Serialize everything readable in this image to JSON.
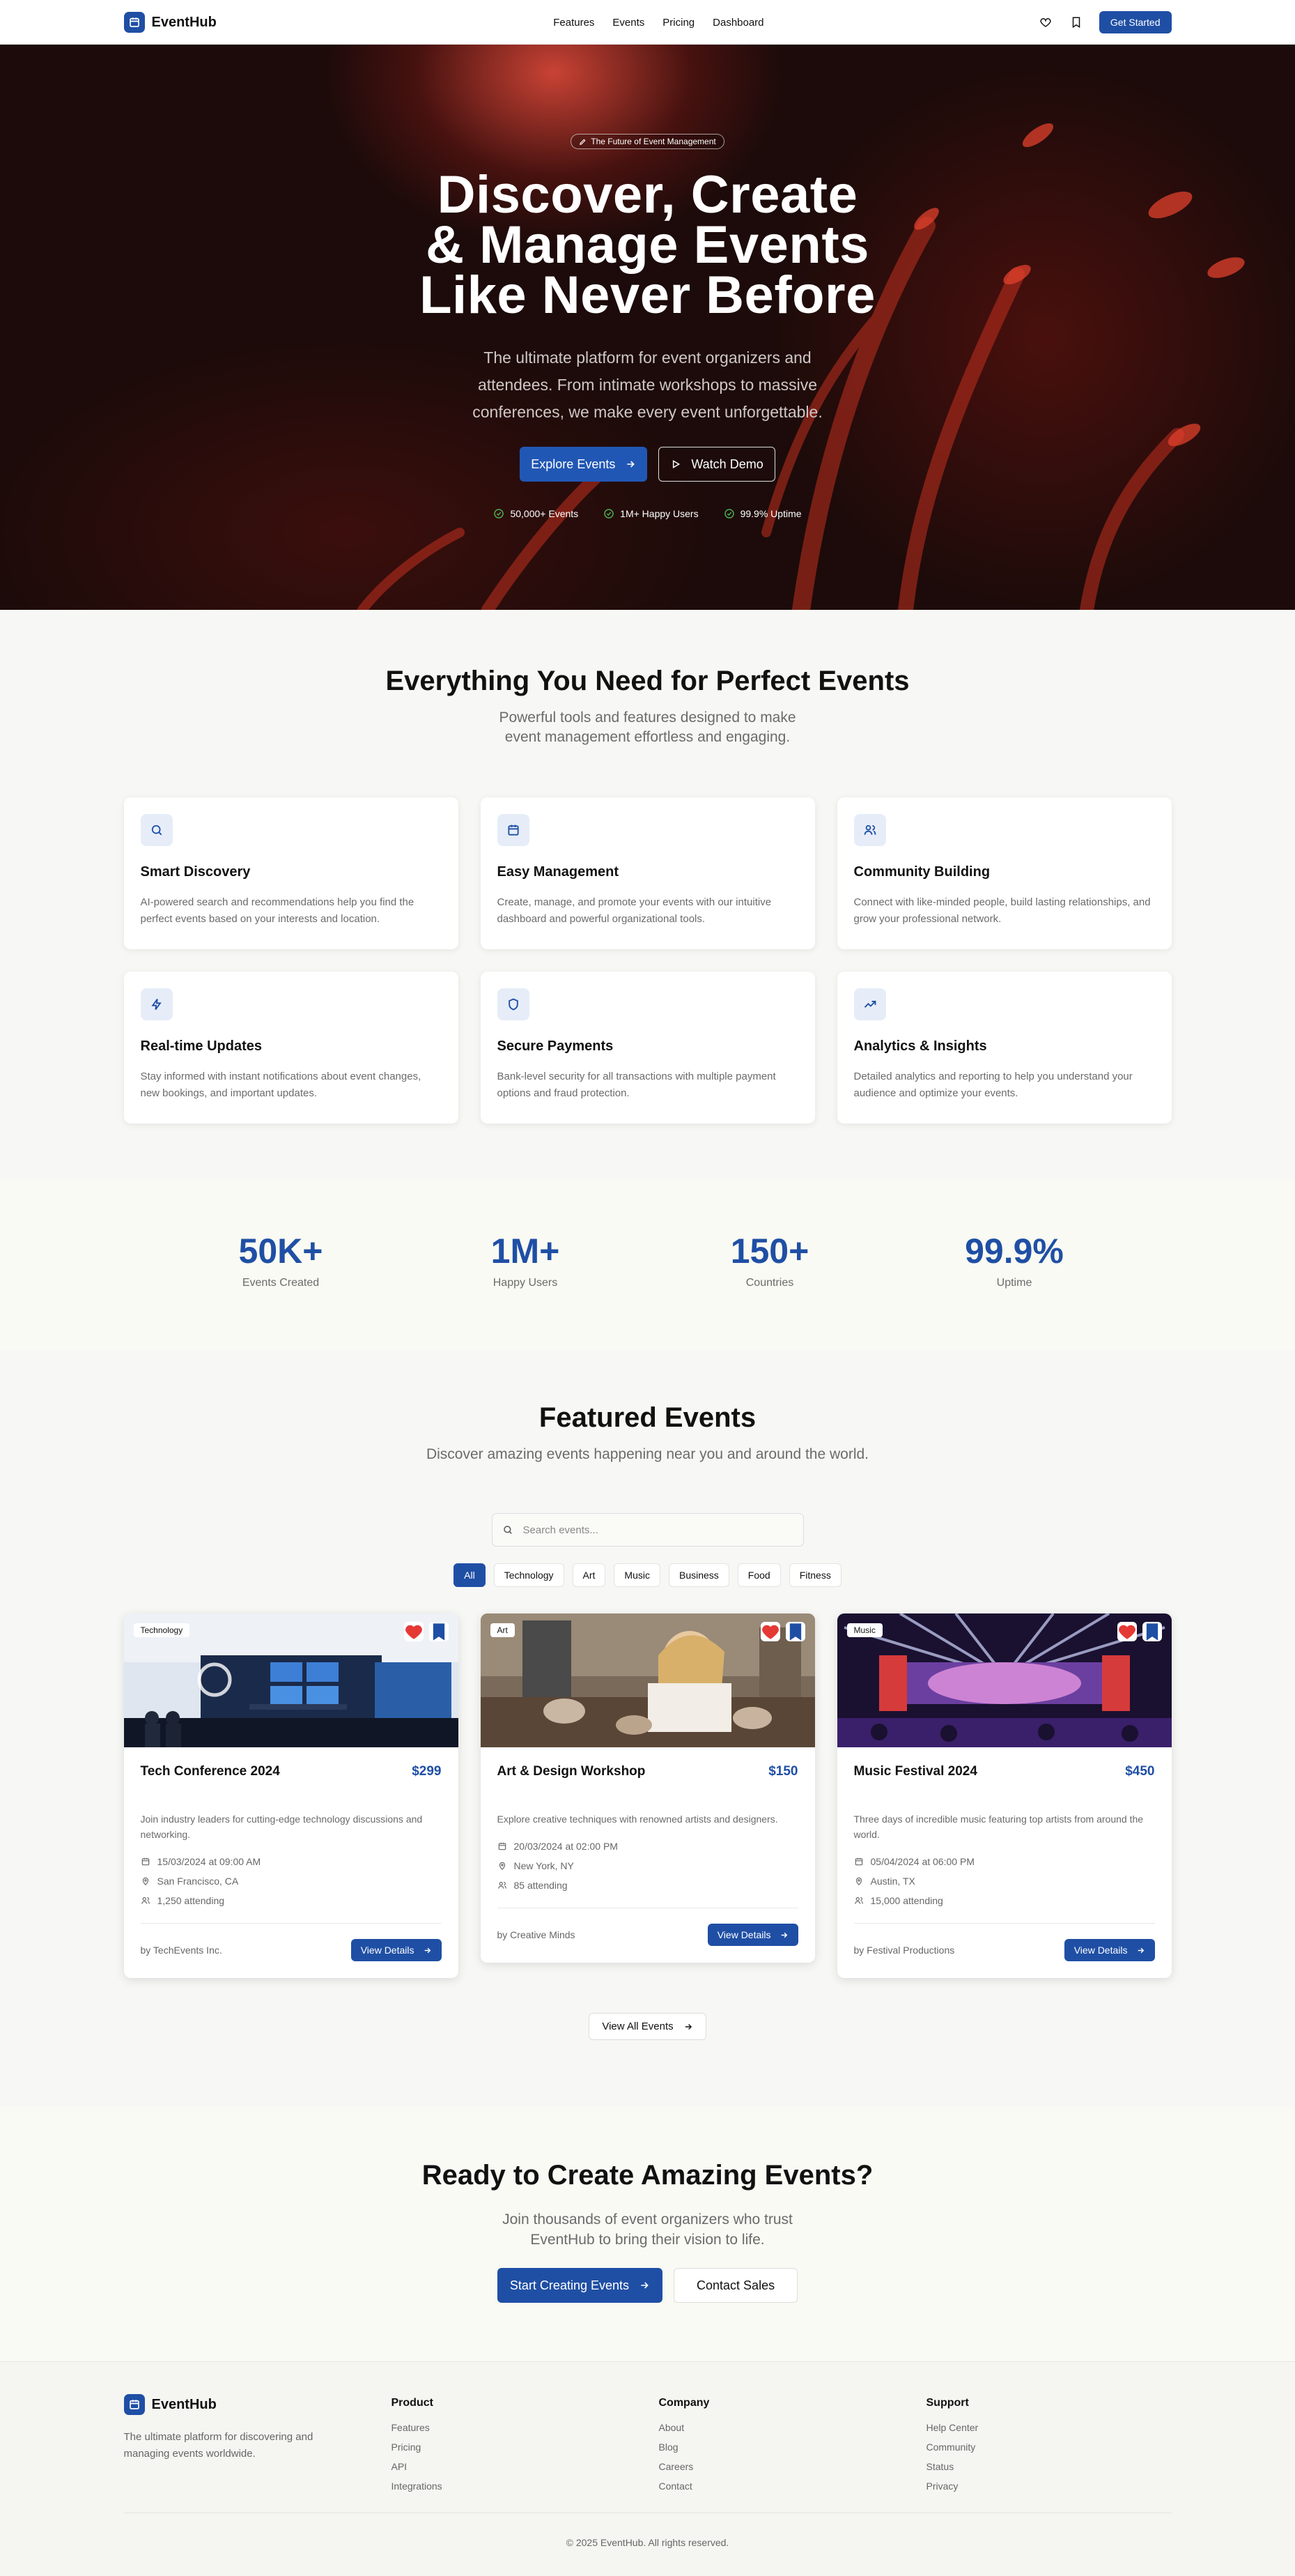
{
  "brand": {
    "name": "EventHub"
  },
  "nav": {
    "links": [
      "Features",
      "Events",
      "Pricing",
      "Dashboard"
    ],
    "cta": "Get Started",
    "colors": {
      "primary": "#1f4fa5"
    }
  },
  "hero": {
    "badge": "The Future of Event Management",
    "title_lines": [
      "Discover, Create",
      "& Manage Events",
      "Like Never Before"
    ],
    "subtitle": "The ultimate platform for event organizers and attendees. From intimate workshops to massive conferences, we make every event unforgettable.",
    "primary_button": "Explore Events",
    "secondary_button": "Watch Demo",
    "stats": [
      "50,000+ Events",
      "1M+ Happy Users",
      "99.9% Uptime"
    ]
  },
  "features": {
    "title": "Everything You Need for Perfect Events",
    "subtitle_lines": [
      "Powerful tools and features designed to make",
      "event management effortless and engaging."
    ],
    "items": [
      {
        "icon": "search-icon",
        "title": "Smart Discovery",
        "desc": "AI-powered search and recommendations help you find the perfect events based on your interests and location."
      },
      {
        "icon": "calendar-icon",
        "title": "Easy Management",
        "desc": "Create, manage, and promote your events with our intuitive dashboard and powerful organizational tools."
      },
      {
        "icon": "users-icon",
        "title": "Community Building",
        "desc": "Connect with like-minded people, build lasting relationships, and grow your professional network."
      },
      {
        "icon": "zap-icon",
        "title": "Real-time Updates",
        "desc": "Stay informed with instant notifications about event changes, new bookings, and important updates."
      },
      {
        "icon": "shield-icon",
        "title": "Secure Payments",
        "desc": "Bank-level security for all transactions with multiple payment options and fraud protection."
      },
      {
        "icon": "trending-up-icon",
        "title": "Analytics & Insights",
        "desc": "Detailed analytics and reporting to help you understand your audience and optimize your events."
      }
    ]
  },
  "stats": [
    {
      "value": "50K+",
      "label": "Events Created"
    },
    {
      "value": "1M+",
      "label": "Happy Users"
    },
    {
      "value": "150+",
      "label": "Countries"
    },
    {
      "value": "99.9%",
      "label": "Uptime"
    }
  ],
  "events": {
    "title": "Featured Events",
    "subtitle": "Discover amazing events happening near you and around the world.",
    "search_placeholder": "Search events...",
    "filters": [
      "All",
      "Technology",
      "Art",
      "Music",
      "Business",
      "Food",
      "Fitness"
    ],
    "active_filter": "All",
    "cards": [
      {
        "tag": "Technology",
        "title": "Tech Conference 2024",
        "price": "$299",
        "desc": "Join industry leaders for cutting-edge technology discussions and networking.",
        "date": "15/03/2024 at 09:00 AM",
        "location": "San Francisco, CA",
        "attending": "1,250 attending",
        "organizer": "by TechEvents Inc.",
        "button": "View Details"
      },
      {
        "tag": "Art",
        "title": "Art & Design Workshop",
        "price": "$150",
        "desc": "Explore creative techniques with renowned artists and designers.",
        "date": "20/03/2024 at 02:00 PM",
        "location": "New York, NY",
        "attending": "85 attending",
        "organizer": "by Creative Minds",
        "button": "View Details"
      },
      {
        "tag": "Music",
        "title": "Music Festival 2024",
        "price": "$450",
        "desc": "Three days of incredible music featuring top artists from around the world.",
        "date": "05/04/2024 at 06:00 PM",
        "location": "Austin, TX",
        "attending": "15,000 attending",
        "organizer": "by Festival Productions",
        "button": "View Details"
      }
    ],
    "view_all": "View All Events"
  },
  "cta": {
    "title": "Ready to Create Amazing Events?",
    "subtitle": "Join thousands of event organizers who trust EventHub to bring their vision to life.",
    "primary_button": "Start Creating Events",
    "secondary_button": "Contact Sales"
  },
  "footer": {
    "desc": "The ultimate platform for discovering and managing events worldwide.",
    "columns": [
      {
        "title": "Product",
        "links": [
          "Features",
          "Pricing",
          "API",
          "Integrations"
        ]
      },
      {
        "title": "Company",
        "links": [
          "About",
          "Blog",
          "Careers",
          "Contact"
        ]
      },
      {
        "title": "Support",
        "links": [
          "Help Center",
          "Community",
          "Status",
          "Privacy"
        ]
      }
    ],
    "copyright": "© 2025 EventHub. All rights reserved."
  }
}
